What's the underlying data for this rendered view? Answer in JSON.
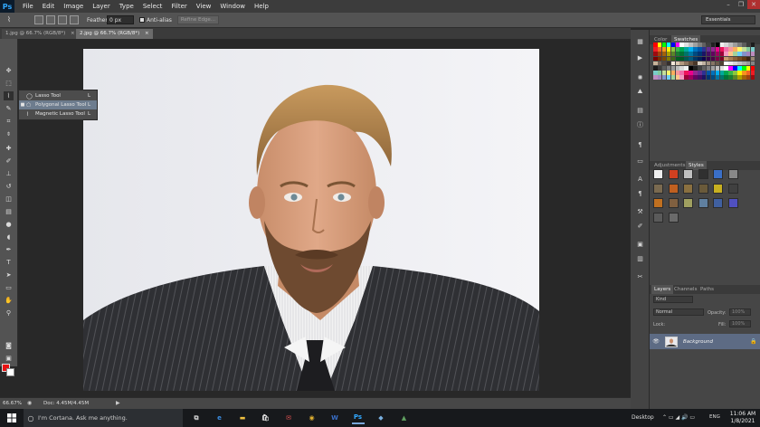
{
  "app": {
    "logo": "Ps"
  },
  "menu": [
    "File",
    "Edit",
    "Image",
    "Layer",
    "Type",
    "Select",
    "Filter",
    "View",
    "Window",
    "Help"
  ],
  "window_controls": {
    "minimize": "–",
    "restore": "❐",
    "close": "✕"
  },
  "options": {
    "feather_label": "Feather:",
    "feather_value": "0 px",
    "antialias_label": "Anti-alias",
    "antialias_checked": true,
    "refine_edge_label": "Refine Edge...",
    "workspace": "Essentials"
  },
  "tabs": [
    {
      "label": "1.jpg @ 66.7% (RGB/8*)",
      "close": "×",
      "active": false
    },
    {
      "label": "2.jpg @ 66.7% (RGB/8*)",
      "close": "×",
      "active": true
    }
  ],
  "tool_flyout": {
    "items": [
      {
        "name": "Lasso Tool",
        "key": "L",
        "selected": false,
        "icon": "lasso-icon"
      },
      {
        "name": "Polygonal Lasso Tool",
        "key": "L",
        "selected": true,
        "icon": "polygonal-lasso-icon"
      },
      {
        "name": "Magnetic Lasso Tool",
        "key": "L",
        "selected": false,
        "icon": "magnetic-lasso-icon"
      }
    ]
  },
  "colors": {
    "foreground": "#e81212",
    "background": "#ffffff"
  },
  "status": {
    "zoom": "66.67%",
    "doc_size": "Doc: 4.45M/4.45M"
  },
  "panels": {
    "color_tabs": [
      "Color",
      "Swatches"
    ],
    "adjust_tabs": [
      "Adjustments",
      "Styles"
    ],
    "layers_tabs": [
      "Layers",
      "Channels",
      "Paths"
    ],
    "layers": {
      "kind": "Kind",
      "blend_mode": "Normal",
      "opacity_label": "Opacity:",
      "opacity_value": "100%",
      "lock_label": "Lock:",
      "fill_label": "Fill:",
      "fill_value": "100%",
      "items": [
        {
          "name": "Background",
          "visible": true,
          "locked": true
        }
      ]
    }
  },
  "taskbar": {
    "search_placeholder": "I'm Cortana. Ask me anything.",
    "apps": [
      {
        "name": "task-view",
        "glyph": "⧉",
        "color": "#dddddd"
      },
      {
        "name": "edge",
        "glyph": "e",
        "color": "#3b8de0"
      },
      {
        "name": "file-explorer",
        "glyph": "▬",
        "color": "#f0c040"
      },
      {
        "name": "store",
        "glyph": "🛍",
        "color": "#dddddd"
      },
      {
        "name": "mail",
        "glyph": "✉",
        "color": "#e05050"
      },
      {
        "name": "chrome",
        "glyph": "◉",
        "color": "#e0b030"
      },
      {
        "name": "word",
        "glyph": "W",
        "color": "#3a6fc8"
      },
      {
        "name": "photoshop",
        "glyph": "Ps",
        "color": "#31a8ff"
      },
      {
        "name": "app-9",
        "glyph": "◆",
        "color": "#7ab0e0"
      },
      {
        "name": "app-10",
        "glyph": "▲",
        "color": "#60a060"
      }
    ],
    "desktop": "Desktop",
    "language": "ENG",
    "time": "11:06 AM",
    "date": "1/8/2021"
  }
}
